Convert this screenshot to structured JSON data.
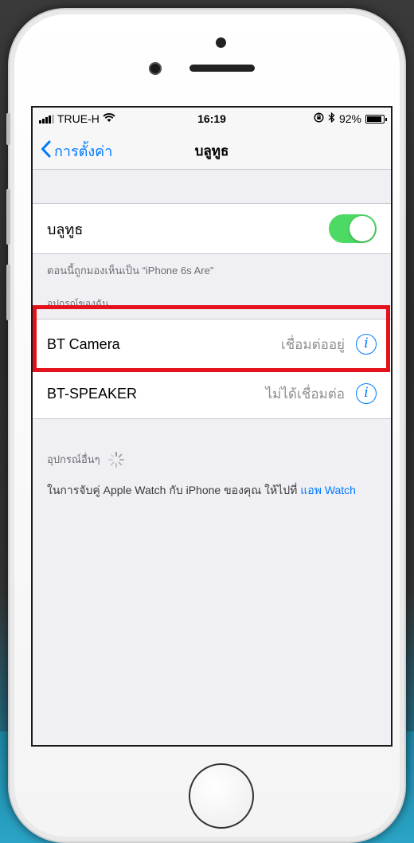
{
  "status_bar": {
    "carrier": "TRUE-H",
    "time": "16:19",
    "battery": "92%"
  },
  "nav": {
    "back_label": "การตั้งค่า",
    "title": "บลูทูธ"
  },
  "bluetooth": {
    "label": "บลูทูธ",
    "enabled": true,
    "visible_as": "ตอนนี้ถูกมองเห็นเป็น “iPhone 6s Are”"
  },
  "my_devices": {
    "header": "อุปกรณ์ของฉัน",
    "items": [
      {
        "name": "BT Camera",
        "status": "เชื่อมต่ออยู่"
      },
      {
        "name": "BT-SPEAKER",
        "status": "ไม่ได้เชื่อมต่อ"
      }
    ]
  },
  "other_devices": {
    "header": "อุปกรณ์อื่นๆ"
  },
  "watch_note": {
    "text": "ในการจับคู่ Apple Watch กับ iPhone ของคุณ ให้ไปที่ ",
    "link": "แอพ Watch"
  },
  "colors": {
    "accent": "#007aff",
    "toggle_on": "#4cd964",
    "highlight": "#e5111b"
  }
}
